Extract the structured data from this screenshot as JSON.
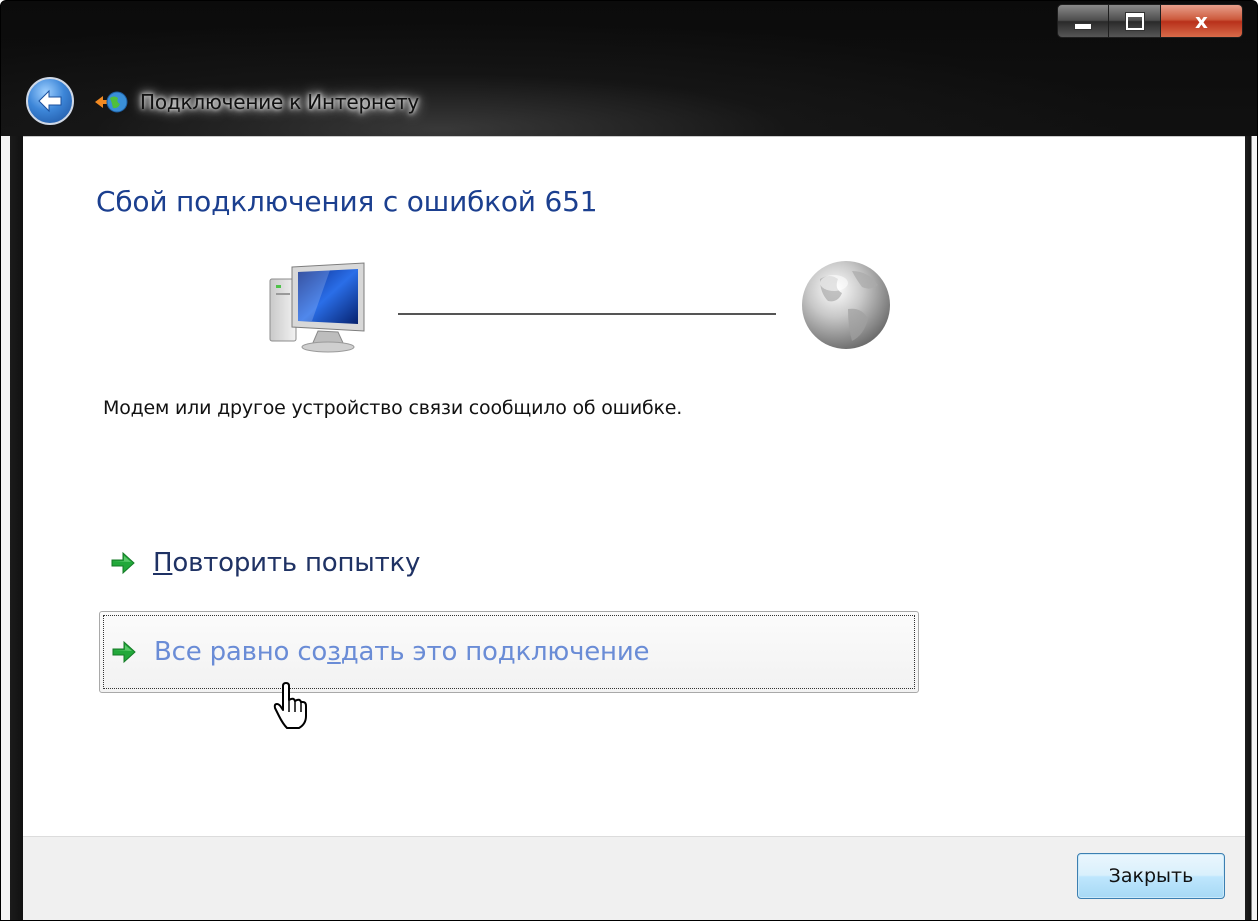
{
  "window": {
    "title": "Подключение к Интернету",
    "close_glyph": "x"
  },
  "content": {
    "heading": "Сбой подключения с ошибкой 651",
    "message": "Модем или другое устройство связи сообщило об ошибке.",
    "retry": {
      "mnemonic": "П",
      "rest": "овторить попытку"
    },
    "create_anyway": {
      "before": "Все равно со",
      "mnemonic": "з",
      "after": "дать это подключение"
    }
  },
  "footer": {
    "close_label": "Закрыть"
  },
  "colors": {
    "heading": "#1b3f8f",
    "link": "#1f3264",
    "link_hover": "#6a8cd6",
    "arrow": "#22a83a"
  }
}
